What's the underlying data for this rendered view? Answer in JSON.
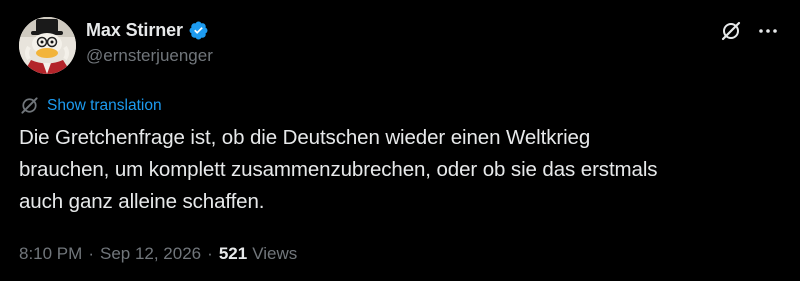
{
  "author": {
    "display_name": "Max Stirner",
    "handle": "@ernsterjuenger",
    "verified": true
  },
  "actions": {
    "grok_icon": "grok-icon",
    "more_icon": "more-icon"
  },
  "translation": {
    "label": "Show translation"
  },
  "tweet": {
    "text_lines": [
      "Die Gretchenfrage ist, ob die Deutschen wieder einen Weltkrieg",
      "brauchen, um komplett zusammenzubrechen, oder ob sie das erstmals",
      "auch ganz alleine schaffen."
    ]
  },
  "meta": {
    "time": "8:10 PM",
    "separator": "·",
    "date": "Sep 12, 2026",
    "views_count": "521",
    "views_label": "Views"
  },
  "colors": {
    "background": "#000000",
    "text_primary": "#e7e9ea",
    "text_secondary": "#71767b",
    "accent": "#1d9bf0"
  }
}
